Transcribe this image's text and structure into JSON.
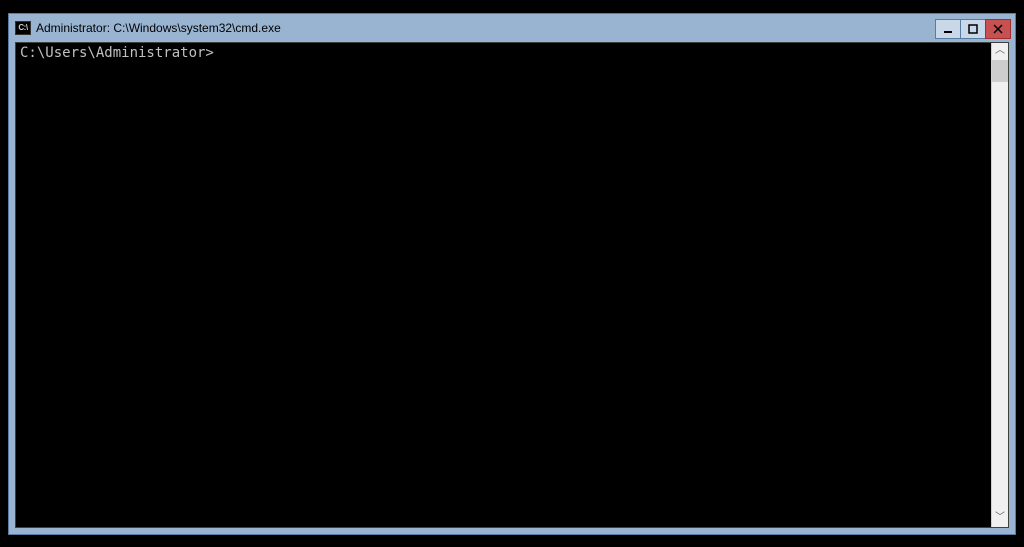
{
  "window": {
    "title": "Administrator: C:\\Windows\\system32\\cmd.exe",
    "icon_label": "C:\\"
  },
  "console": {
    "prompt": "C:\\Users\\Administrator>"
  }
}
